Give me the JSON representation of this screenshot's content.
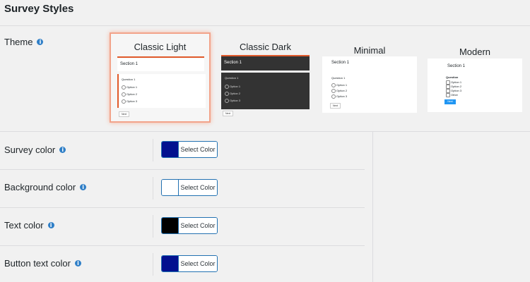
{
  "page": {
    "title": "Survey Styles"
  },
  "theme": {
    "label": "Theme",
    "info_icon": "i",
    "options": [
      {
        "name": "Classic Light",
        "selected": true,
        "section_title": "Section 1",
        "question": "Question 1",
        "options": [
          "Option 1",
          "Option 2",
          "Option 3"
        ],
        "button": "Next"
      },
      {
        "name": "Classic Dark",
        "selected": false,
        "section_title": "Section 1",
        "question": "Question 1",
        "options": [
          "Option 1",
          "Option 2",
          "Option 3"
        ],
        "button": "Next"
      },
      {
        "name": "Minimal",
        "selected": false,
        "section_title": "Section 1",
        "question": "Question 1",
        "options": [
          "Option 1",
          "Option 2",
          "Option 3"
        ],
        "button": "Next"
      },
      {
        "name": "Modern",
        "selected": false,
        "section_title": "Section 1",
        "question": "Question",
        "options": [
          "Option 1",
          "Option 2",
          "Option 3",
          "Other"
        ],
        "button": "Next"
      }
    ]
  },
  "colors": [
    {
      "label": "Survey color",
      "button": "Select Color",
      "value": "#02118f"
    },
    {
      "label": "Background color",
      "button": "Select Color",
      "value": "#ffffff"
    },
    {
      "label": "Text color",
      "button": "Select Color",
      "value": "#000000"
    },
    {
      "label": "Button text color",
      "button": "Select Color",
      "value": "#02118f"
    }
  ],
  "accent": {
    "selected_border": "#f2a38a",
    "classic_light_bar": "#e05a2b",
    "modern_button": "#2196f3"
  }
}
